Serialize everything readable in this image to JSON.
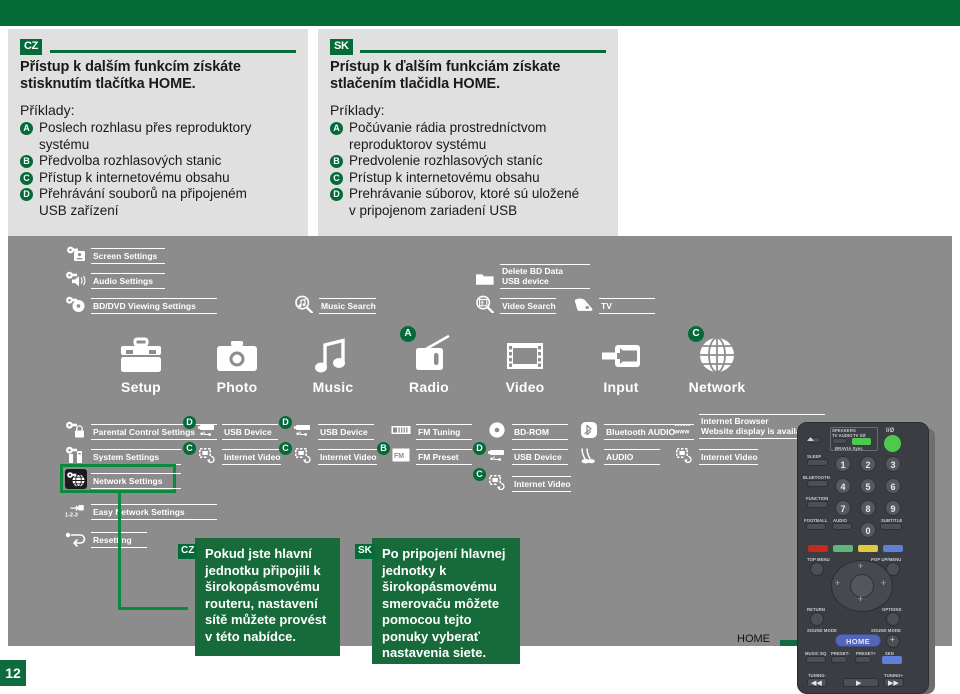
{
  "page": {
    "number": "12"
  },
  "notes": [
    {
      "lang": "CZ",
      "heading": "Přístup k dalším funkcím získáte stisknutím tlačítka HOME.",
      "subheading": "Příklady:",
      "items": [
        {
          "badge": "A",
          "text": "Poslech rozhlasu přes reproduktory",
          "cont": "systému"
        },
        {
          "badge": "B",
          "text": "Předvolba rozhlasových stanic",
          "cont": ""
        },
        {
          "badge": "C",
          "text": "Přístup k internetovému obsahu",
          "cont": ""
        },
        {
          "badge": "D",
          "text": "Přehrávání souborů na připojeném",
          "cont": "USB zařízení"
        }
      ]
    },
    {
      "lang": "SK",
      "heading": "Prístup k ďalším funkciám získate stlačením tlačidla HOME.",
      "subheading": "Príklady:",
      "items": [
        {
          "badge": "A",
          "text": "Počúvanie rádia prostredníctvom",
          "cont": "reproduktorov systému"
        },
        {
          "badge": "B",
          "text": "Predvolenie rozhlasových staníc",
          "cont": ""
        },
        {
          "badge": "C",
          "text": "Prístup k internetovému obsahu",
          "cont": ""
        },
        {
          "badge": "D",
          "text": "Prehrávanie súborov, ktoré sú uložené",
          "cont": "v pripojenom zariadení USB"
        }
      ]
    }
  ],
  "menu": {
    "upper_entries": [
      {
        "label": "Screen Settings",
        "icon": "screen-settings-icon"
      },
      {
        "label": "Audio Settings",
        "icon": "audio-settings-icon"
      },
      {
        "label": "BD/DVD Viewing Settings",
        "icon": "bd-dvd-viewing-settings-icon"
      },
      {
        "label": "Music Search",
        "icon": "music-search-icon"
      },
      {
        "label": "Delete BD Data",
        "label2": "USB device",
        "icon": "delete-bd-data-icon"
      },
      {
        "label": "Video Search",
        "icon": "video-search-icon"
      },
      {
        "label": "TV",
        "icon": "tv-icon"
      }
    ],
    "categories": [
      {
        "name": "Setup",
        "icon": "toolbox-icon",
        "badge": ""
      },
      {
        "name": "Photo",
        "icon": "camera-icon",
        "badge": ""
      },
      {
        "name": "Music",
        "icon": "music-note-icon",
        "badge": ""
      },
      {
        "name": "Radio",
        "icon": "radio-icon",
        "badge": "A"
      },
      {
        "name": "Video",
        "icon": "film-strip-icon",
        "badge": ""
      },
      {
        "name": "Input",
        "icon": "input-arrow-icon",
        "badge": ""
      },
      {
        "name": "Network",
        "icon": "globe-icon",
        "badge": "C"
      }
    ],
    "setup_items": [
      {
        "label": "Parental Control Settings",
        "icon": "parental-control-icon",
        "badge": ""
      },
      {
        "label": "System Settings",
        "icon": "system-settings-icon",
        "badge": ""
      },
      {
        "label": "Network Settings",
        "icon": "network-settings-icon",
        "badge": "",
        "highlighted": true
      },
      {
        "label": "Easy Network Settings",
        "icon": "easy-network-icon",
        "badge": ""
      },
      {
        "label": "Resetting",
        "icon": "resetting-icon",
        "badge": ""
      }
    ],
    "photo_items": [
      {
        "label": "USB Device",
        "icon": "usb-device-icon",
        "badge": "D"
      },
      {
        "label": "Internet Video",
        "icon": "internet-video-icon",
        "badge": "C"
      }
    ],
    "music_items": [
      {
        "label": "USB Device",
        "icon": "usb-device-icon",
        "badge": "D"
      },
      {
        "label": "Internet Video",
        "icon": "internet-video-icon",
        "badge": "C"
      }
    ],
    "radio_items": [
      {
        "label": "FM Tuning",
        "icon": "fm-tuning-icon",
        "badge": ""
      },
      {
        "label": "FM Preset",
        "icon": "fm-preset-icon",
        "badge": "B"
      }
    ],
    "video_items": [
      {
        "label": "BD-ROM",
        "icon": "disc-icon",
        "badge": ""
      },
      {
        "label": "USB Device",
        "icon": "usb-device-icon",
        "badge": "D"
      },
      {
        "label": "Internet Video",
        "icon": "internet-video-icon",
        "badge": "C"
      }
    ],
    "input_items": [
      {
        "label": "Bluetooth AUDIO",
        "icon": "bluetooth-icon",
        "badge": ""
      },
      {
        "label": "AUDIO",
        "icon": "audio-cable-icon",
        "badge": ""
      }
    ],
    "network_items": [
      {
        "label": "Internet Browser",
        "label2": "Website display is available",
        "icon": "www-icon",
        "badge": ""
      },
      {
        "label": "Internet Video",
        "icon": "internet-video-icon",
        "badge": ""
      }
    ]
  },
  "callouts": [
    {
      "lang": "CZ",
      "text": "Pokud jste hlavní jednotku připojili k širokopásmovému routeru, nastavení sítě můžete provést v této nabídce."
    },
    {
      "lang": "SK",
      "text": "Po pripojení hlavnej jednotky k širokopásmovému smerovaču môžete pomocou tejto ponuky vyberať nastavenia siete."
    }
  ],
  "remote": {
    "home_caption": "HOME",
    "home_button": "HOME",
    "labels": {
      "eject": "",
      "speakers": "SPEAKERS",
      "tv_audio": "TV  AUDIO",
      "tv_power": "TV I/Ø",
      "bravia": "BRAVIA Sync",
      "power": "I/Ø",
      "sleep": "SLEEP",
      "bluetooth": "BLUETOOTH",
      "function": "FUNCTION",
      "football": "FOOTBALL",
      "audio": "AUDIO",
      "subtitle": "SUBTITLE",
      "top_menu": "TOP MENU",
      "popup_menu": "POP UP/MENU",
      "return": "RETURN",
      "options": "OPTIONS",
      "sound_mode_minus": "SOUND MODE",
      "sound_mode_plus": "SOUND MODE",
      "music_eq": "MUSIC EQ",
      "preset_minus": "PRESET-",
      "preset_plus": "PRESET+",
      "sen": "SEN",
      "tuning_minus": "TUNING-",
      "tuning_plus": "TUNING+"
    },
    "numbers": [
      "1",
      "2",
      "3",
      "4",
      "5",
      "6",
      "7",
      "8",
      "9",
      "0"
    ]
  },
  "colors": {
    "green": "#046a38",
    "callout_green": "#176b3a",
    "panel_grey": "#8c8c8c",
    "note_grey": "#e0e0e0",
    "highlight": "#0a8a3c"
  }
}
